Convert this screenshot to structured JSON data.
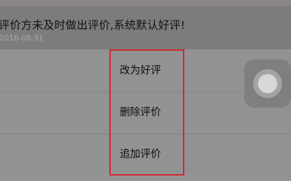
{
  "review": {
    "caption": "·················",
    "text": "评价方未及时做出评价,系统默认好评!",
    "date": "2016-08-31"
  },
  "menu": {
    "items": [
      {
        "label": "改为好评"
      },
      {
        "label": "删除评价"
      },
      {
        "label": "追加评价"
      }
    ],
    "highlight_color": "#d0252a"
  },
  "assistive_touch": {
    "icon": "assistive-touch-icon"
  }
}
